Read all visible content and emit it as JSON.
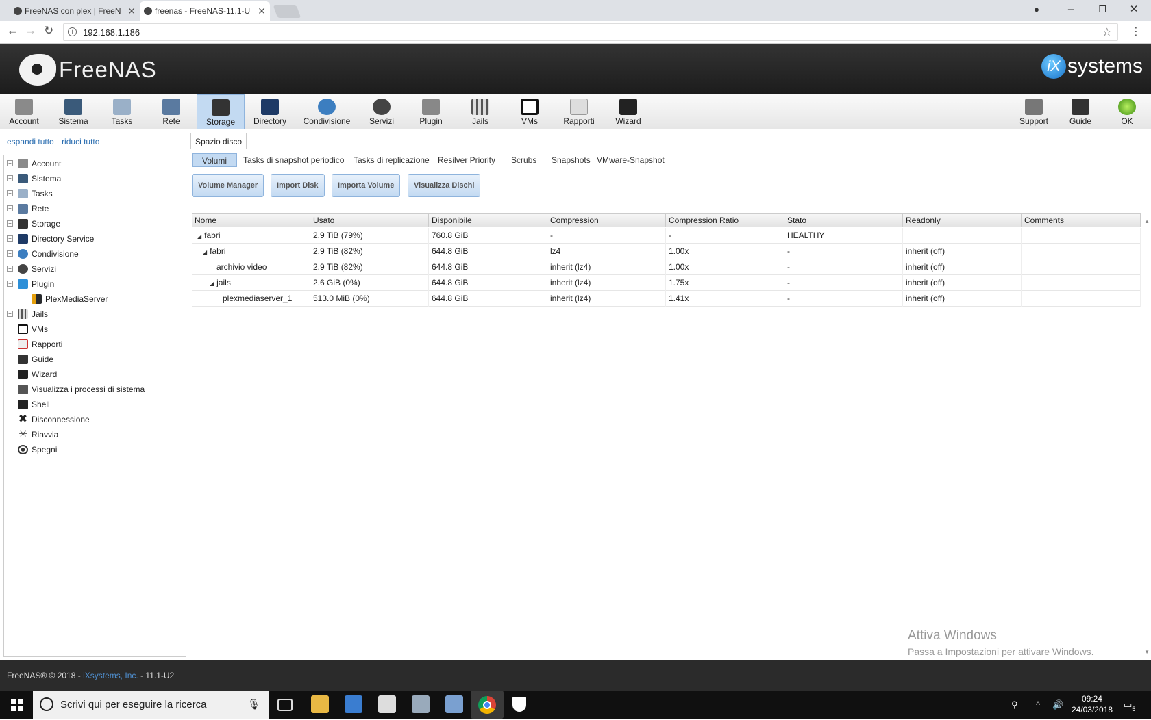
{
  "browser": {
    "tabs": [
      {
        "label": "FreeNAS con plex | FreeN"
      },
      {
        "label": "freenas - FreeNAS-11.1-U"
      }
    ],
    "url": "192.168.1.186"
  },
  "header": {
    "logo_text": "FreeNAS",
    "ix_mark": "iX",
    "ix_text": "systems"
  },
  "toolbar": {
    "items": [
      {
        "label": "Account"
      },
      {
        "label": "Sistema"
      },
      {
        "label": "Tasks"
      },
      {
        "label": "Rete"
      },
      {
        "label": "Storage"
      },
      {
        "label": "Directory"
      },
      {
        "label": "Condivisione"
      },
      {
        "label": "Servizi"
      },
      {
        "label": "Plugin"
      },
      {
        "label": "Jails"
      },
      {
        "label": "VMs"
      },
      {
        "label": "Rapporti"
      },
      {
        "label": "Wizard"
      }
    ],
    "right_items": [
      {
        "label": "Support"
      },
      {
        "label": "Guide"
      },
      {
        "label": "OK"
      }
    ],
    "active": "Storage"
  },
  "sidebar": {
    "expand_all": "espandi tutto",
    "collapse_all": "riduci tutto",
    "items": [
      {
        "label": "Account",
        "expander": "+"
      },
      {
        "label": "Sistema",
        "expander": "+"
      },
      {
        "label": "Tasks",
        "expander": "+"
      },
      {
        "label": "Rete",
        "expander": "+"
      },
      {
        "label": "Storage",
        "expander": "+"
      },
      {
        "label": "Directory Service",
        "expander": "+"
      },
      {
        "label": "Condivisione",
        "expander": "+"
      },
      {
        "label": "Servizi",
        "expander": "+"
      },
      {
        "label": "Plugin",
        "expander": "−"
      },
      {
        "label": "PlexMediaServer",
        "expander": ""
      },
      {
        "label": "Jails",
        "expander": "+"
      },
      {
        "label": "VMs",
        "expander": ""
      },
      {
        "label": "Rapporti",
        "expander": ""
      },
      {
        "label": "Guide",
        "expander": ""
      },
      {
        "label": "Wizard",
        "expander": ""
      },
      {
        "label": "Visualizza i processi di sistema",
        "expander": ""
      },
      {
        "label": "Shell",
        "expander": ""
      },
      {
        "label": "Disconnessione",
        "expander": ""
      },
      {
        "label": "Riavvia",
        "expander": ""
      },
      {
        "label": "Spegni",
        "expander": ""
      }
    ]
  },
  "main": {
    "tab": "Spazio disco",
    "subtabs": [
      {
        "label": "Volumi"
      },
      {
        "label": "Tasks di snapshot periodico"
      },
      {
        "label": "Tasks di replicazione"
      },
      {
        "label": "Resilver Priority"
      },
      {
        "label": "Scrubs"
      },
      {
        "label": "Snapshots"
      },
      {
        "label": "VMware-Snapshot"
      }
    ],
    "buttons": [
      {
        "label": "Volume Manager"
      },
      {
        "label": "Import Disk"
      },
      {
        "label": "Importa Volume"
      },
      {
        "label": "Visualizza Dischi"
      }
    ],
    "table": {
      "columns": [
        "Nome",
        "Usato",
        "Disponibile",
        "Compression",
        "Compression Ratio",
        "Stato",
        "Readonly",
        "Comments"
      ],
      "rows": [
        {
          "name": "fabri",
          "arrow": "◢",
          "used": "2.9 TiB (79%)",
          "avail": "760.8 GiB",
          "comp": "-",
          "ratio": "-",
          "state": "HEALTHY",
          "ro": "",
          "comments": ""
        },
        {
          "name": "fabri",
          "arrow": "◢",
          "used": "2.9 TiB (82%)",
          "avail": "644.8 GiB",
          "comp": "lz4",
          "ratio": "1.00x",
          "state": "-",
          "ro": "inherit (off)",
          "comments": ""
        },
        {
          "name": "archivio video",
          "arrow": "",
          "used": "2.9 TiB (82%)",
          "avail": "644.8 GiB",
          "comp": "inherit (lz4)",
          "ratio": "1.00x",
          "state": "-",
          "ro": "inherit (off)",
          "comments": ""
        },
        {
          "name": "jails",
          "arrow": "◢",
          "used": "2.6 GiB (0%)",
          "avail": "644.8 GiB",
          "comp": "inherit (lz4)",
          "ratio": "1.75x",
          "state": "-",
          "ro": "inherit (off)",
          "comments": ""
        },
        {
          "name": "plexmediaserver_1",
          "arrow": "",
          "used": "513.0 MiB (0%)",
          "avail": "644.8 GiB",
          "comp": "inherit (lz4)",
          "ratio": "1.41x",
          "state": "-",
          "ro": "inherit (off)",
          "comments": ""
        }
      ]
    },
    "watermark": {
      "title": "Attiva Windows",
      "subtitle": "Passa a Impostazioni per attivare Windows."
    }
  },
  "footer": {
    "prefix": "FreeNAS® © 2018 - ",
    "link": "iXsystems, Inc.",
    "suffix": " - 11.1-U2"
  },
  "taskbar": {
    "search_placeholder": "Scrivi qui per eseguire la ricerca",
    "time": "09:24",
    "date": "24/03/2018",
    "notif_count": "5"
  },
  "colors": {
    "active_bg": "#c3daf2",
    "link": "#2a6db0",
    "header_bg": "#1c1c1c"
  }
}
